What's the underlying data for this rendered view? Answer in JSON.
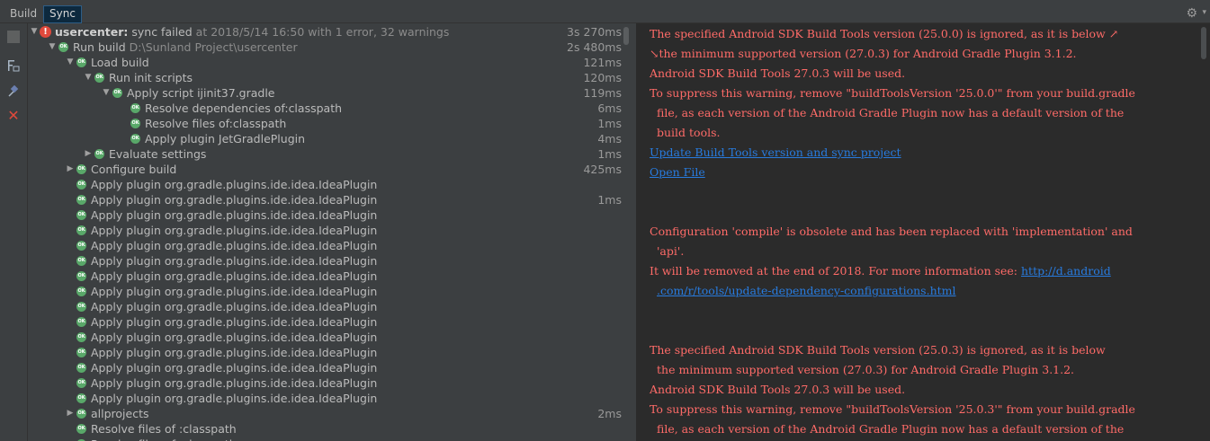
{
  "tabs": {
    "build": "Build",
    "sync": "Sync"
  },
  "toolbar": {
    "gear": "⚙",
    "caret": "▾",
    "close": "✕"
  },
  "tree": [
    {
      "indent": 0,
      "arrow": "▼",
      "icon": "error",
      "label": "usercenter:",
      "bold": true,
      "rest": " sync failed",
      "meta": "   at 2018/5/14 16:50    with 1 error, 32 warnings",
      "time": "3s 270ms"
    },
    {
      "indent": 1,
      "arrow": "▼",
      "icon": "ok",
      "label": "Run build",
      "meta": "  D:\\Sunland Project\\usercenter",
      "time": "2s 480ms"
    },
    {
      "indent": 2,
      "arrow": "▼",
      "icon": "ok",
      "label": "Load build",
      "meta": "",
      "time": "121ms"
    },
    {
      "indent": 3,
      "arrow": "▼",
      "icon": "ok",
      "label": "Run init scripts",
      "meta": "",
      "time": "120ms"
    },
    {
      "indent": 4,
      "arrow": "▼",
      "icon": "ok",
      "label": "Apply script ijinit37.gradle",
      "meta": "",
      "time": "119ms"
    },
    {
      "indent": 5,
      "arrow": "",
      "icon": "ok",
      "label": "Resolve dependencies of:classpath",
      "meta": "",
      "time": "6ms"
    },
    {
      "indent": 5,
      "arrow": "",
      "icon": "ok",
      "label": "Resolve files of:classpath",
      "meta": "",
      "time": "1ms"
    },
    {
      "indent": 5,
      "arrow": "",
      "icon": "ok",
      "label": "Apply plugin JetGradlePlugin",
      "meta": "",
      "time": "4ms"
    },
    {
      "indent": 3,
      "arrow": "▶",
      "icon": "ok",
      "label": "Evaluate settings",
      "meta": "",
      "time": "1ms"
    },
    {
      "indent": 2,
      "arrow": "▶",
      "icon": "ok",
      "label": "Configure build",
      "meta": "",
      "time": "425ms"
    },
    {
      "indent": 2,
      "arrow": "",
      "icon": "ok",
      "label": "Apply plugin org.gradle.plugins.ide.idea.IdeaPlugin",
      "meta": "",
      "time": ""
    },
    {
      "indent": 2,
      "arrow": "",
      "icon": "ok",
      "label": "Apply plugin org.gradle.plugins.ide.idea.IdeaPlugin",
      "meta": "",
      "time": "1ms"
    },
    {
      "indent": 2,
      "arrow": "",
      "icon": "ok",
      "label": "Apply plugin org.gradle.plugins.ide.idea.IdeaPlugin",
      "meta": "",
      "time": ""
    },
    {
      "indent": 2,
      "arrow": "",
      "icon": "ok",
      "label": "Apply plugin org.gradle.plugins.ide.idea.IdeaPlugin",
      "meta": "",
      "time": ""
    },
    {
      "indent": 2,
      "arrow": "",
      "icon": "ok",
      "label": "Apply plugin org.gradle.plugins.ide.idea.IdeaPlugin",
      "meta": "",
      "time": ""
    },
    {
      "indent": 2,
      "arrow": "",
      "icon": "ok",
      "label": "Apply plugin org.gradle.plugins.ide.idea.IdeaPlugin",
      "meta": "",
      "time": ""
    },
    {
      "indent": 2,
      "arrow": "",
      "icon": "ok",
      "label": "Apply plugin org.gradle.plugins.ide.idea.IdeaPlugin",
      "meta": "",
      "time": ""
    },
    {
      "indent": 2,
      "arrow": "",
      "icon": "ok",
      "label": "Apply plugin org.gradle.plugins.ide.idea.IdeaPlugin",
      "meta": "",
      "time": ""
    },
    {
      "indent": 2,
      "arrow": "",
      "icon": "ok",
      "label": "Apply plugin org.gradle.plugins.ide.idea.IdeaPlugin",
      "meta": "",
      "time": ""
    },
    {
      "indent": 2,
      "arrow": "",
      "icon": "ok",
      "label": "Apply plugin org.gradle.plugins.ide.idea.IdeaPlugin",
      "meta": "",
      "time": ""
    },
    {
      "indent": 2,
      "arrow": "",
      "icon": "ok",
      "label": "Apply plugin org.gradle.plugins.ide.idea.IdeaPlugin",
      "meta": "",
      "time": ""
    },
    {
      "indent": 2,
      "arrow": "",
      "icon": "ok",
      "label": "Apply plugin org.gradle.plugins.ide.idea.IdeaPlugin",
      "meta": "",
      "time": ""
    },
    {
      "indent": 2,
      "arrow": "",
      "icon": "ok",
      "label": "Apply plugin org.gradle.plugins.ide.idea.IdeaPlugin",
      "meta": "",
      "time": ""
    },
    {
      "indent": 2,
      "arrow": "",
      "icon": "ok",
      "label": "Apply plugin org.gradle.plugins.ide.idea.IdeaPlugin",
      "meta": "",
      "time": ""
    },
    {
      "indent": 2,
      "arrow": "",
      "icon": "ok",
      "label": "Apply plugin org.gradle.plugins.ide.idea.IdeaPlugin",
      "meta": "",
      "time": ""
    },
    {
      "indent": 2,
      "arrow": "▶",
      "icon": "ok",
      "label": "allprojects",
      "meta": "",
      "time": "2ms"
    },
    {
      "indent": 2,
      "arrow": "",
      "icon": "ok",
      "label": "Resolve files of :classpath",
      "meta": "",
      "time": ""
    },
    {
      "indent": 2,
      "arrow": "",
      "icon": "ok",
      "label": "Resolve files of :classpath",
      "meta": "",
      "time": ""
    }
  ],
  "console": [
    {
      "text": "The specified Android SDK Build Tools version (25.0.0) is ignored, as it is below ↗",
      "kind": "err",
      "indent": false
    },
    {
      "text": "↘the minimum supported version (27.0.3) for Android Gradle Plugin 3.1.2.",
      "kind": "err",
      "indent": false
    },
    {
      "text": "Android SDK Build Tools 27.0.3 will be used.",
      "kind": "err",
      "indent": false
    },
    {
      "text": "To suppress this warning, remove \"buildToolsVersion '25.0.0'\" from your build.gradle",
      "kind": "err",
      "indent": false
    },
    {
      "text": "file, as each version of the Android Gradle Plugin now has a default version of the",
      "kind": "err",
      "indent": true
    },
    {
      "text": "build tools.",
      "kind": "err",
      "indent": true
    },
    {
      "text": "Update Build Tools version and sync project",
      "kind": "link",
      "indent": false
    },
    {
      "text": "Open File",
      "kind": "link",
      "indent": false
    },
    {
      "text": "",
      "kind": "err",
      "indent": false
    },
    {
      "text": "",
      "kind": "err",
      "indent": false
    },
    {
      "text": "Configuration 'compile' is obsolete and has been replaced with 'implementation' and",
      "kind": "err",
      "indent": false
    },
    {
      "text": "'api'.",
      "kind": "err",
      "indent": true
    },
    {
      "text": "It will be removed at the end of 2018. For more information see: ",
      "kind": "mixed",
      "linkText": "http://d.android",
      "indent": false
    },
    {
      "text": ".com/r/tools/update-dependency-configurations.html",
      "kind": "link",
      "indent": true
    },
    {
      "text": "",
      "kind": "err",
      "indent": false
    },
    {
      "text": "",
      "kind": "err",
      "indent": false
    },
    {
      "text": "The specified Android SDK Build Tools version (25.0.3) is ignored, as it is below",
      "kind": "err",
      "indent": false
    },
    {
      "text": "the minimum supported version (27.0.3) for Android Gradle Plugin 3.1.2.",
      "kind": "err",
      "indent": true
    },
    {
      "text": "Android SDK Build Tools 27.0.3 will be used.",
      "kind": "err",
      "indent": false
    },
    {
      "text": "To suppress this warning, remove \"buildToolsVersion '25.0.3'\" from your build.gradle",
      "kind": "err",
      "indent": false
    },
    {
      "text": "file, as each version of the Android Gradle Plugin now has a default version of the",
      "kind": "err",
      "indent": true
    }
  ]
}
